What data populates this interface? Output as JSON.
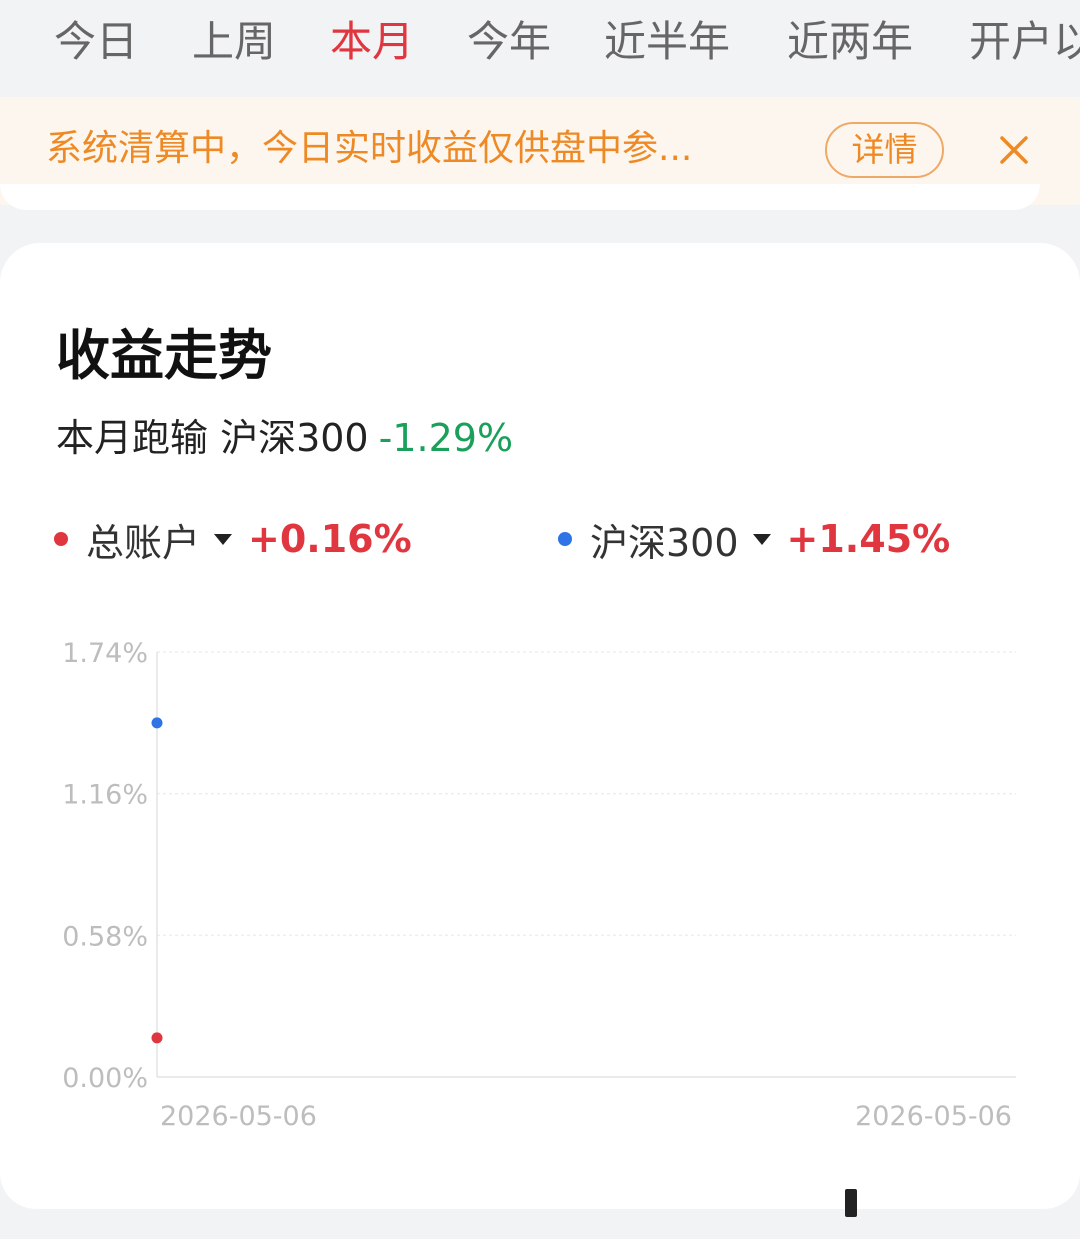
{
  "tabs": [
    {
      "label": "今日",
      "active": false
    },
    {
      "label": "上周",
      "active": false
    },
    {
      "label": "本月",
      "active": true
    },
    {
      "label": "今年",
      "active": false
    },
    {
      "label": "近半年",
      "active": false
    },
    {
      "label": "近两年",
      "active": false
    },
    {
      "label": "开户以",
      "active": false
    }
  ],
  "notice": {
    "text": "系统清算中，今日实时收益仅供盘中参...",
    "detail_label": "详情",
    "close_icon": "close-icon",
    "accent_color": "#ee8a26"
  },
  "card": {
    "title": "收益走势",
    "subtitle_prefix": "本月跑输 沪深300",
    "subtitle_value": "-1.29%",
    "legend": [
      {
        "name": "总账户",
        "value": "+0.16%",
        "dot_color": "#e0363f"
      },
      {
        "name": "沪深300",
        "value": "+1.45%",
        "dot_color": "#2e74e6"
      }
    ]
  },
  "chart_data": {
    "type": "scatter",
    "title": "",
    "xlabel": "",
    "ylabel": "",
    "y_ticks": [
      "1.74%",
      "1.16%",
      "0.58%",
      "0.00%"
    ],
    "ylim": [
      0,
      1.74
    ],
    "x_tick_labels": [
      "2026-05-06",
      "2026-05-06"
    ],
    "grid": true,
    "series": [
      {
        "name": "总账户",
        "color": "#e0363f",
        "x": [
          "2026-05-06"
        ],
        "y": [
          0.16
        ]
      },
      {
        "name": "沪深300",
        "color": "#2e74e6",
        "x": [
          "2026-05-06"
        ],
        "y": [
          1.45
        ]
      }
    ]
  }
}
